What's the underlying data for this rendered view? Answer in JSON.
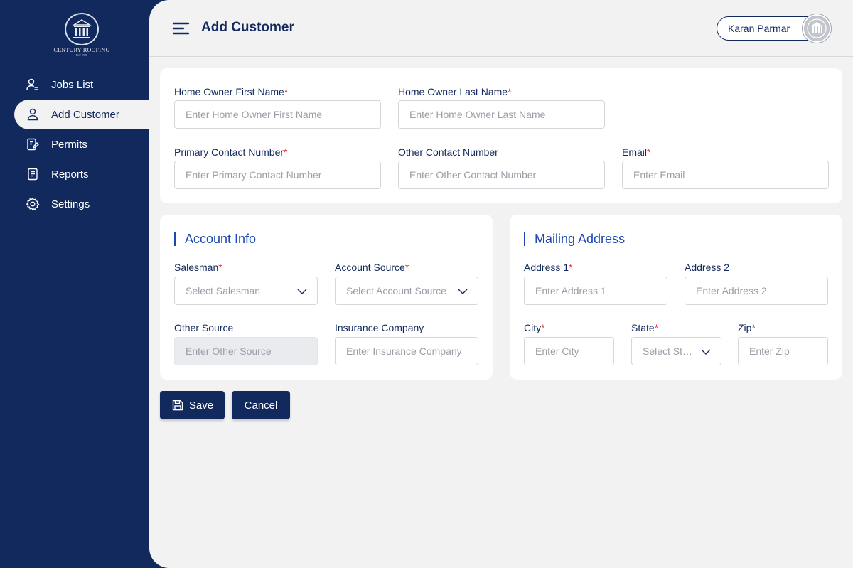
{
  "brand": {
    "logo_text": "CENTURY ROOFING",
    "logo_sub": "EST 1998"
  },
  "sidebar": {
    "items": [
      {
        "label": "Jobs List",
        "icon": "user-list-icon",
        "active": false
      },
      {
        "label": "Add Customer",
        "icon": "user-icon",
        "active": true
      },
      {
        "label": "Permits",
        "icon": "document-edit-icon",
        "active": false
      },
      {
        "label": "Reports",
        "icon": "report-icon",
        "active": false
      },
      {
        "label": "Settings",
        "icon": "gear-icon",
        "active": false
      }
    ]
  },
  "header": {
    "title": "Add Customer",
    "user_name": "Karan Parmar"
  },
  "owner": {
    "first_name": {
      "label": "Home Owner First Name",
      "required": "*",
      "placeholder": "Enter Home Owner First Name"
    },
    "last_name": {
      "label": "Home Owner Last Name",
      "required": "*",
      "placeholder": "Enter Home Owner Last Name"
    },
    "primary_contact": {
      "label": "Primary Contact Number",
      "required": "*",
      "placeholder": "Enter Primary Contact Number"
    },
    "other_contact": {
      "label": "Other Contact Number",
      "placeholder": "Enter Other Contact Number"
    },
    "email": {
      "label": "Email",
      "required": "*",
      "placeholder": "Enter Email"
    }
  },
  "account": {
    "title": "Account Info",
    "salesman": {
      "label": "Salesman",
      "required": "*",
      "value": "Select Salesman"
    },
    "account_source": {
      "label": "Account Source",
      "required": "*",
      "value": "Select Account Source"
    },
    "other_source": {
      "label": "Other Source",
      "placeholder": "Enter Other Source"
    },
    "insurance": {
      "label": "Insurance Company",
      "placeholder": "Enter Insurance Company"
    }
  },
  "mailing": {
    "title": "Mailing Address",
    "address1": {
      "label": "Address 1",
      "required": "*",
      "placeholder": "Enter Address 1"
    },
    "address2": {
      "label": "Address 2",
      "placeholder": "Enter Address 2"
    },
    "city": {
      "label": "City",
      "required": "*",
      "placeholder": "Enter City"
    },
    "state": {
      "label": "State",
      "required": "*",
      "value": "Select State"
    },
    "zip": {
      "label": "Zip",
      "required": "*",
      "placeholder": "Enter Zip"
    }
  },
  "actions": {
    "save_label": "Save",
    "cancel_label": "Cancel"
  },
  "colors": {
    "navy": "#12295e",
    "accent_blue": "#1b48b5",
    "required_red": "#e0323d",
    "background": "#f2f2f2"
  }
}
